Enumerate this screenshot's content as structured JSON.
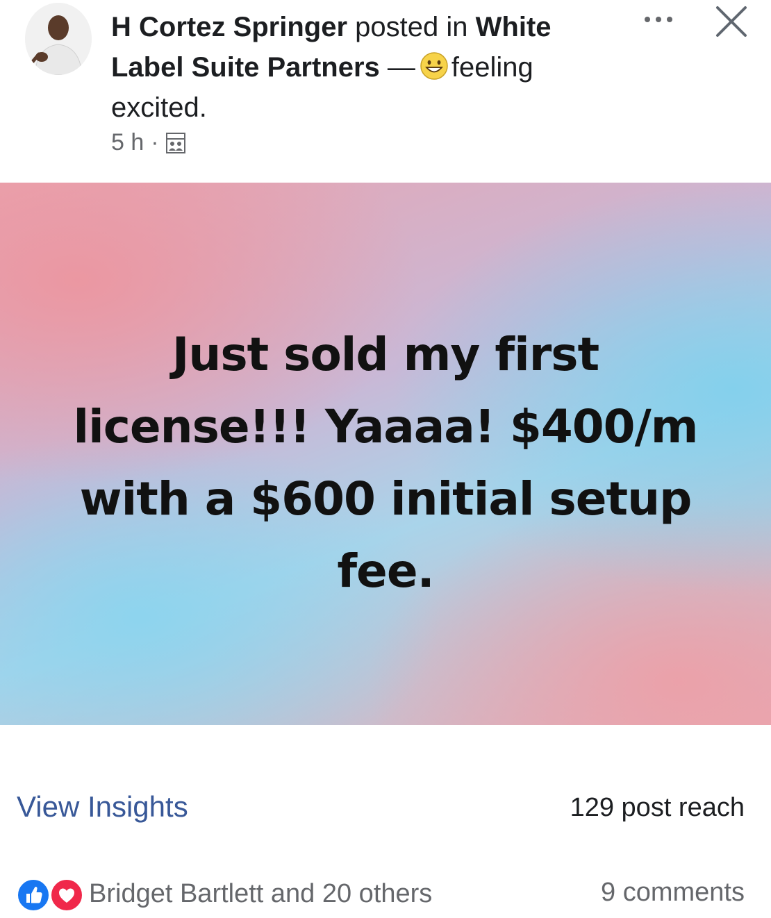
{
  "header": {
    "author_name": "H Cortez Springer",
    "posted_in_text": "posted in",
    "group_name": "White Label Suite Partners",
    "dash": "—",
    "feeling_text": "feeling excited.",
    "timestamp": "5 h",
    "separator": "·",
    "feeling_icon": "grinning-face-emoji",
    "privacy_icon": "group-icon"
  },
  "post": {
    "text": "Just sold my first license!!! Yaaaa! $400/m with a $600 initial setup fee."
  },
  "footer": {
    "view_insights_label": "View Insights",
    "post_reach": "129 post reach",
    "reactions_summary": "Bridget Bartlett and 20 others",
    "comments_count": "9 comments",
    "reaction_icons": [
      "like-icon",
      "love-icon"
    ]
  },
  "colors": {
    "link_blue": "#385898",
    "like_blue": "#1877f2",
    "love_red": "#f0284a",
    "muted_text": "#65676b"
  }
}
